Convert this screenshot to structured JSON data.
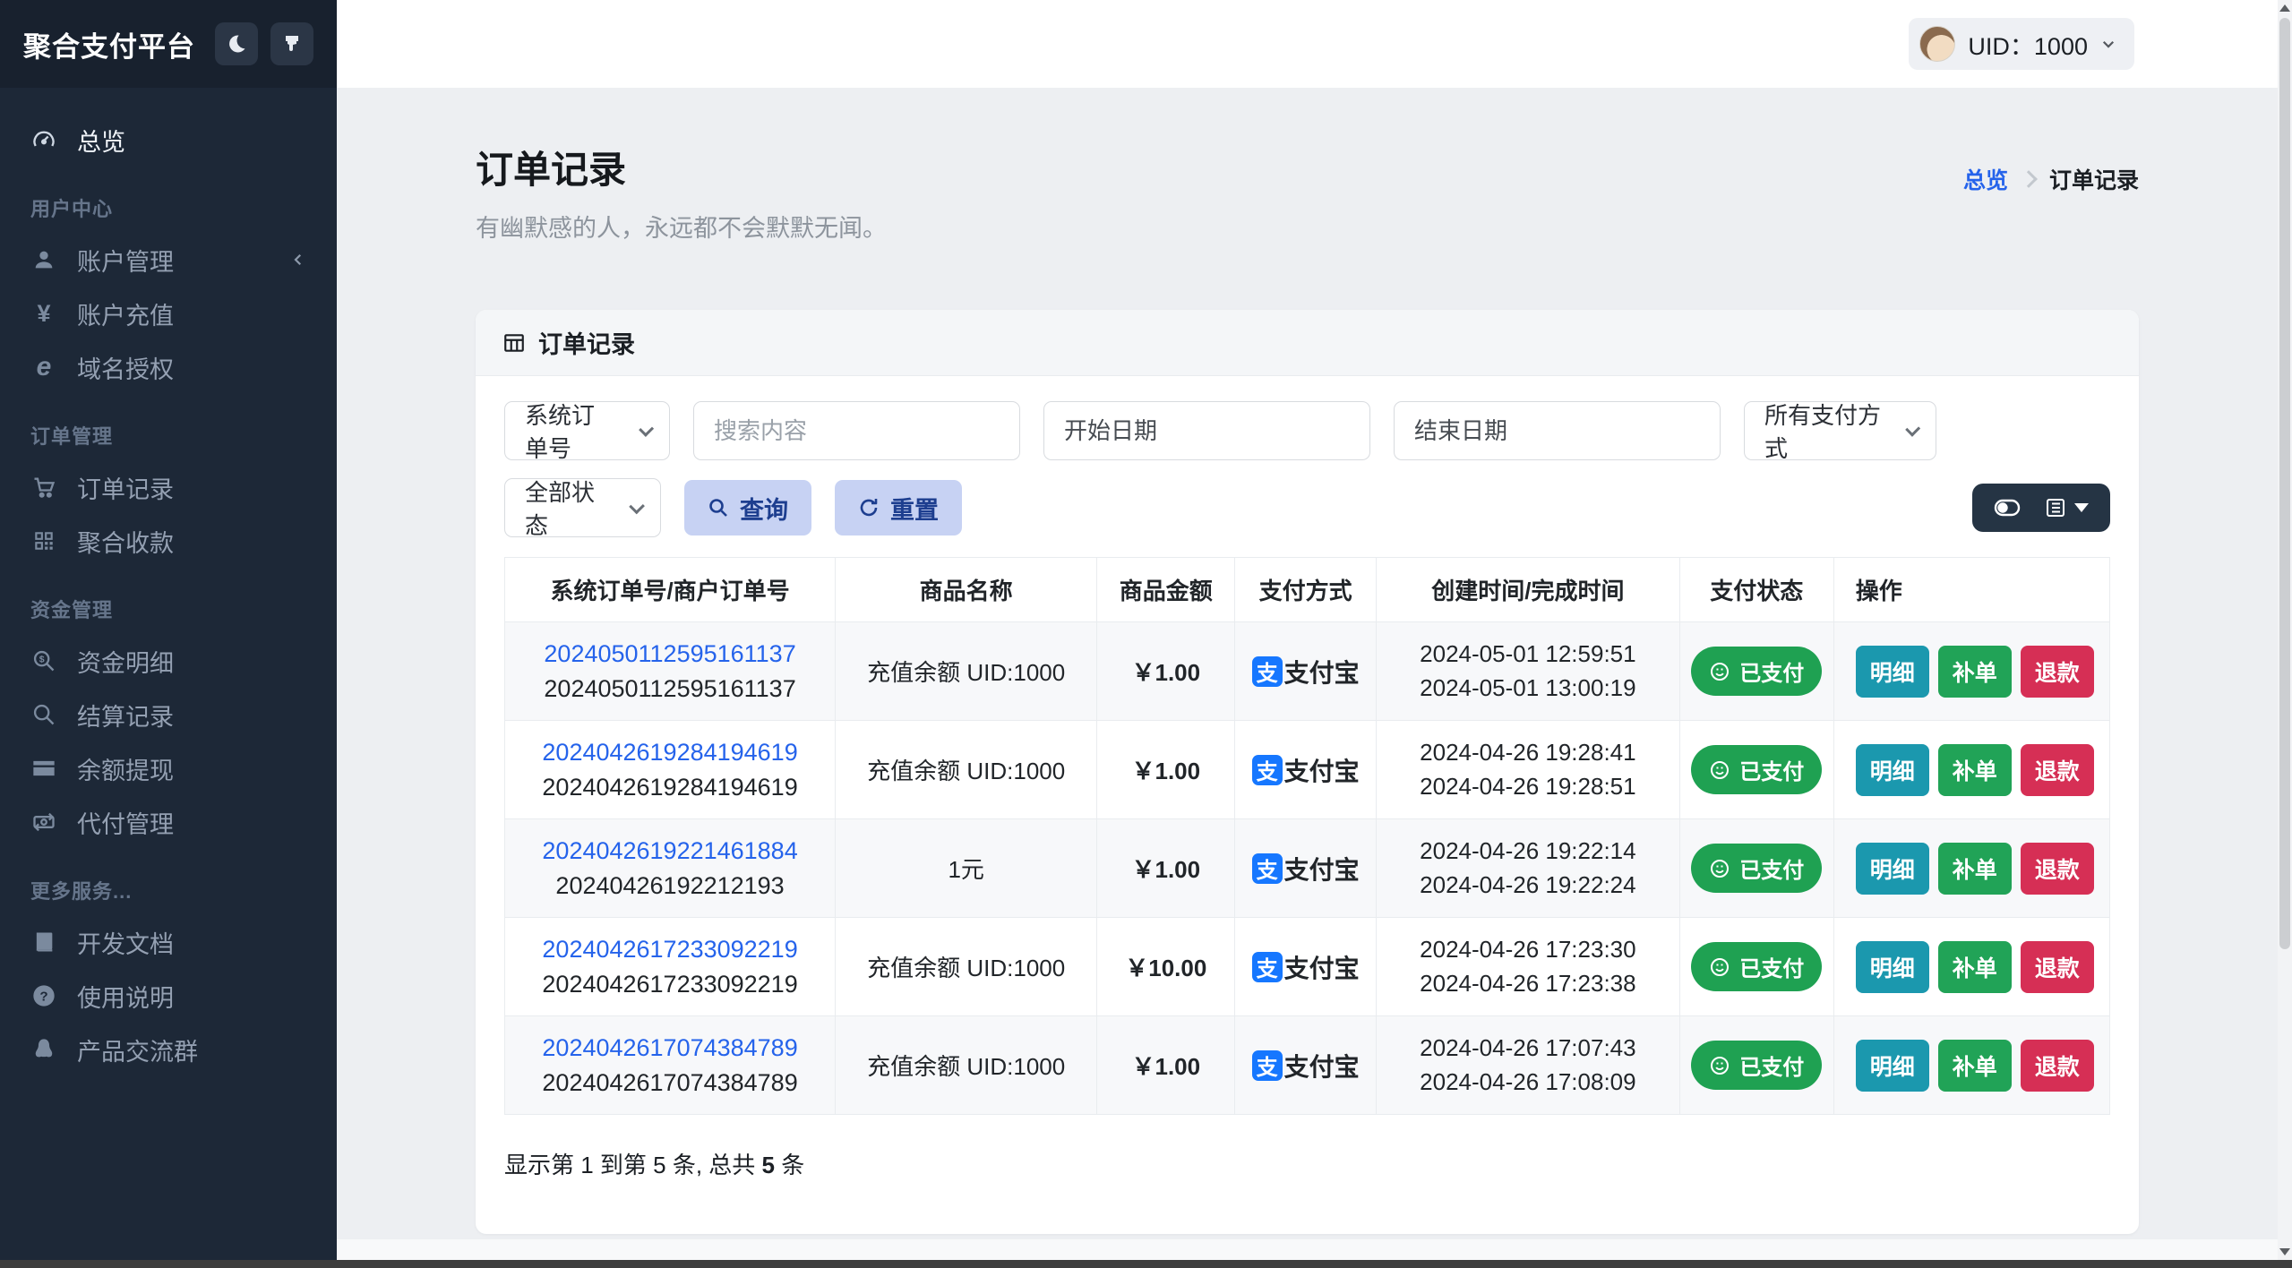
{
  "brand": {
    "title": "聚合支付平台"
  },
  "topbar": {
    "uid_label": "UID：1000"
  },
  "sidebar": {
    "overview": {
      "label": "总览"
    },
    "sections": [
      {
        "label": "用户中心",
        "items": [
          {
            "label": "账户管理"
          },
          {
            "label": "账户充值"
          },
          {
            "label": "域名授权"
          }
        ]
      },
      {
        "label": "订单管理",
        "items": [
          {
            "label": "订单记录"
          },
          {
            "label": "聚合收款"
          }
        ]
      },
      {
        "label": "资金管理",
        "items": [
          {
            "label": "资金明细"
          },
          {
            "label": "结算记录"
          },
          {
            "label": "余额提现"
          },
          {
            "label": "代付管理"
          }
        ]
      },
      {
        "label": "更多服务...",
        "items": [
          {
            "label": "开发文档"
          },
          {
            "label": "使用说明"
          },
          {
            "label": "产品交流群"
          }
        ]
      }
    ]
  },
  "page": {
    "title": "订单记录",
    "subtitle": "有幽默感的人，永远都不会默默无闻。",
    "breadcrumb": {
      "root": "总览",
      "current": "订单记录"
    }
  },
  "card": {
    "header": "订单记录"
  },
  "filters": {
    "search_type": "系统订单号",
    "search_placeholder": "搜索内容",
    "start_date_placeholder": "开始日期",
    "end_date_placeholder": "结束日期",
    "pay_method": "所有支付方式",
    "status": "全部状态",
    "query_label": "查询",
    "reset_label": "重置"
  },
  "alipay_glyph": "支",
  "actions": {
    "detail": "明细",
    "reissue": "补单",
    "refund": "退款"
  },
  "table": {
    "columns": [
      "系统订单号/商户订单号",
      "商品名称",
      "商品金额",
      "支付方式",
      "创建时间/完成时间",
      "支付状态",
      "操作"
    ],
    "rows": [
      {
        "sys_no": "2024050112595161137",
        "mch_no": "2024050112595161137",
        "product": "充值余额 UID:1000",
        "amount": "￥1.00",
        "method": "支付宝",
        "created": "2024-05-01 12:59:51",
        "finished": "2024-05-01 13:00:19",
        "status": "已支付"
      },
      {
        "sys_no": "2024042619284194619",
        "mch_no": "2024042619284194619",
        "product": "充值余额 UID:1000",
        "amount": "￥1.00",
        "method": "支付宝",
        "created": "2024-04-26 19:28:41",
        "finished": "2024-04-26 19:28:51",
        "status": "已支付"
      },
      {
        "sys_no": "2024042619221461884",
        "mch_no": "20240426192212193",
        "product": "1元",
        "amount": "￥1.00",
        "method": "支付宝",
        "created": "2024-04-26 19:22:14",
        "finished": "2024-04-26 19:22:24",
        "status": "已支付"
      },
      {
        "sys_no": "2024042617233092219",
        "mch_no": "2024042617233092219",
        "product": "充值余额 UID:1000",
        "amount": "￥10.00",
        "method": "支付宝",
        "created": "2024-04-26 17:23:30",
        "finished": "2024-04-26 17:23:38",
        "status": "已支付"
      },
      {
        "sys_no": "2024042617074384789",
        "mch_no": "2024042617074384789",
        "product": "充值余额 UID:1000",
        "amount": "￥1.00",
        "method": "支付宝",
        "created": "2024-04-26 17:07:43",
        "finished": "2024-04-26 17:08:09",
        "status": "已支付"
      }
    ],
    "footer_prefix": "显示第 1 到第 5 条, 总共 ",
    "footer_total": "5",
    "footer_suffix": " 条"
  },
  "colors": {
    "accent_blue": "#2563eb",
    "alipay_blue": "#1677ff",
    "success_green": "#1fa152",
    "info_teal": "#1b98ae",
    "danger_red": "#d62f55",
    "sidebar_bg": "#1d2837"
  }
}
